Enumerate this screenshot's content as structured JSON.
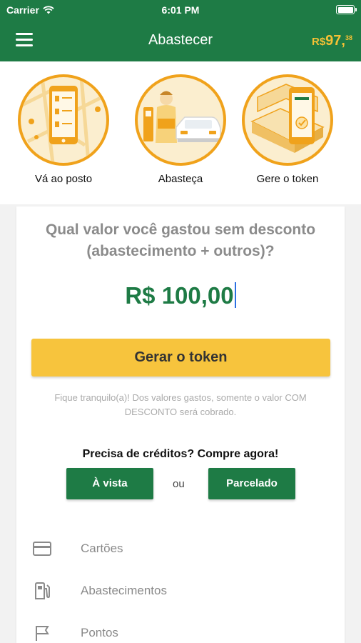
{
  "status_bar": {
    "carrier": "Carrier",
    "time": "6:01 PM"
  },
  "header": {
    "title": "Abastecer",
    "balance_currency": "R$",
    "balance_int": "97,",
    "balance_cents": "38"
  },
  "steps": [
    {
      "label": "Vá ao posto",
      "icon": "phone-map-icon"
    },
    {
      "label": "Abasteça",
      "icon": "attendant-car-icon"
    },
    {
      "label": "Gere o token",
      "icon": "phone-token-icon"
    }
  ],
  "form": {
    "question": "Qual valor você gastou sem desconto (abastecimento + outros)?",
    "amount_value": "R$ 100,00",
    "submit_label": "Gerar o token",
    "note": "Fique tranquilo(a)! Dos valores gastos, somente o valor COM DESCONTO será cobrado."
  },
  "credits": {
    "title": "Precisa de créditos? Compre agora!",
    "cash_label": "À vista",
    "or_label": "ou",
    "installments_label": "Parcelado"
  },
  "menu": [
    {
      "label": "Cartões",
      "icon": "credit-card-icon"
    },
    {
      "label": "Abastecimentos",
      "icon": "fuel-pump-icon"
    },
    {
      "label": "Pontos",
      "icon": "flag-icon"
    }
  ],
  "colors": {
    "primary": "#1e7b45",
    "accent": "#f7c43d",
    "illustration": "#f0a21b"
  }
}
